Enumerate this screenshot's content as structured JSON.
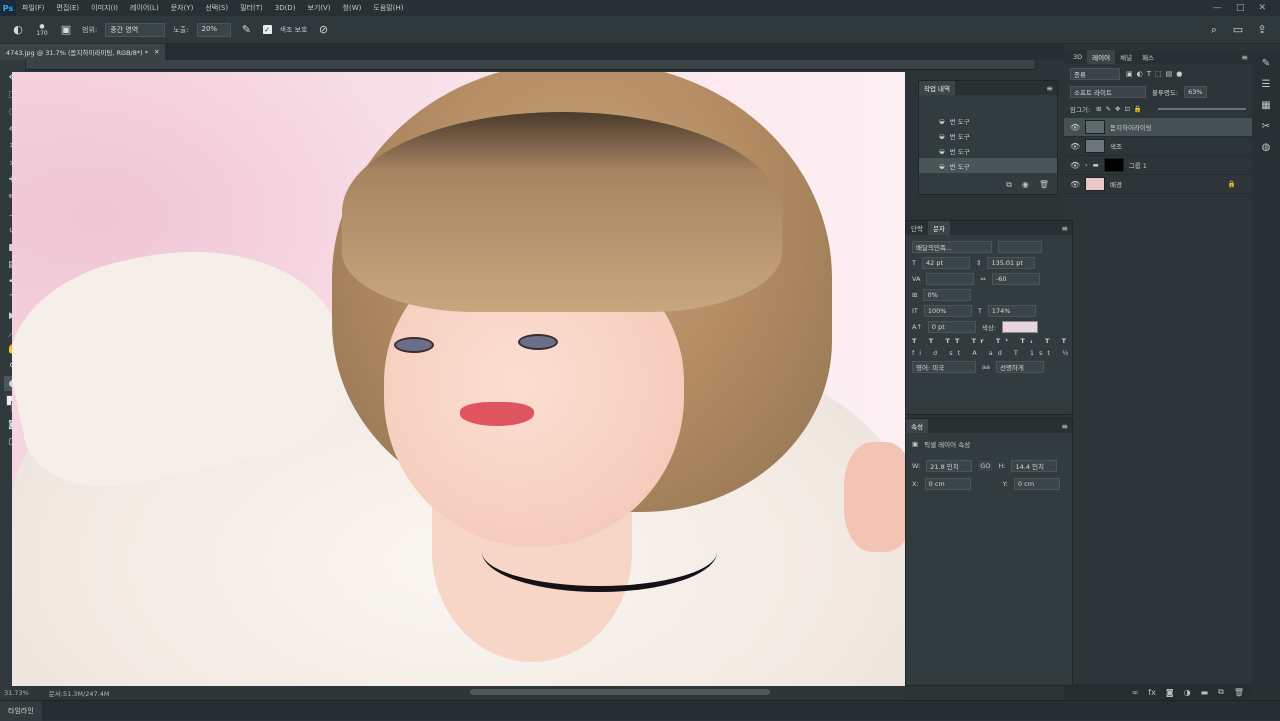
{
  "app": {
    "logo": "Ps"
  },
  "menu": [
    "파일(F)",
    "편집(E)",
    "이미지(I)",
    "레이어(L)",
    "문자(Y)",
    "선택(S)",
    "필터(T)",
    "3D(D)",
    "보기(V)",
    "창(W)",
    "도움말(H)"
  ],
  "window_controls": [
    "—",
    "□",
    "✕"
  ],
  "options": {
    "brush_size": "170",
    "mode_label": "범위:",
    "mode_value": "중간 영역",
    "exposure_label": "노출:",
    "exposure_value": "20%",
    "protect_label": "색조 보호"
  },
  "document": {
    "tab_title": "4743.jpg @ 31.7% (돋지하이라이팅, RGB/8*) *",
    "close": "✕"
  },
  "status": {
    "zoom": "31.73%",
    "doc_size": "문서:51.3M/247.4M"
  },
  "timeline": {
    "label": "타임라인"
  },
  "history": {
    "title": "작업 내역",
    "items": [
      "번 도구",
      "번 도구",
      "번 도구",
      "번 도구"
    ],
    "active_index": 3
  },
  "layers": {
    "tabs": [
      "3D",
      "레이어",
      "채널",
      "패스"
    ],
    "active_tab": 1,
    "filter": "종류",
    "blend_mode": "소프트 라이트",
    "opacity_label": "불투명도:",
    "opacity_value": "63%",
    "lock_label": "잠그기:",
    "items": [
      {
        "name": "돋지하이라이팅",
        "thumb_color": "#5f6a6d",
        "active": true
      },
      {
        "name": "색조",
        "thumb_color": "#6b7478",
        "active": false
      },
      {
        "name": "그룹 1",
        "thumb_color": "#000000",
        "active": false
      },
      {
        "name": "배경",
        "thumb_color": "#e9c8c8",
        "active": false
      }
    ]
  },
  "character": {
    "tabs": [
      "단락",
      "문자"
    ],
    "active_tab": 1,
    "font_family": "배달의민족...",
    "font_size": "42 pt",
    "leading": "135.01 pt",
    "kerning": "",
    "tracking": "-60",
    "scale_pct": "0%",
    "vscale": "100%",
    "hscale": "174%",
    "baseline": "0 pt",
    "color_label": "색상:",
    "color_value": "#e7d5dd",
    "language": "영어: 미국",
    "aa": "선명하게",
    "aa_icon": "aa"
  },
  "properties": {
    "title": "속성",
    "type": "픽셀 레이어 속성",
    "w_label": "W:",
    "w_value": "21.8 인치",
    "h_label": "H:",
    "h_value": "14.4 인치",
    "link": "GO",
    "x_label": "X:",
    "x_value": "0 cm",
    "y_label": "Y:",
    "y_value": "0 cm"
  }
}
